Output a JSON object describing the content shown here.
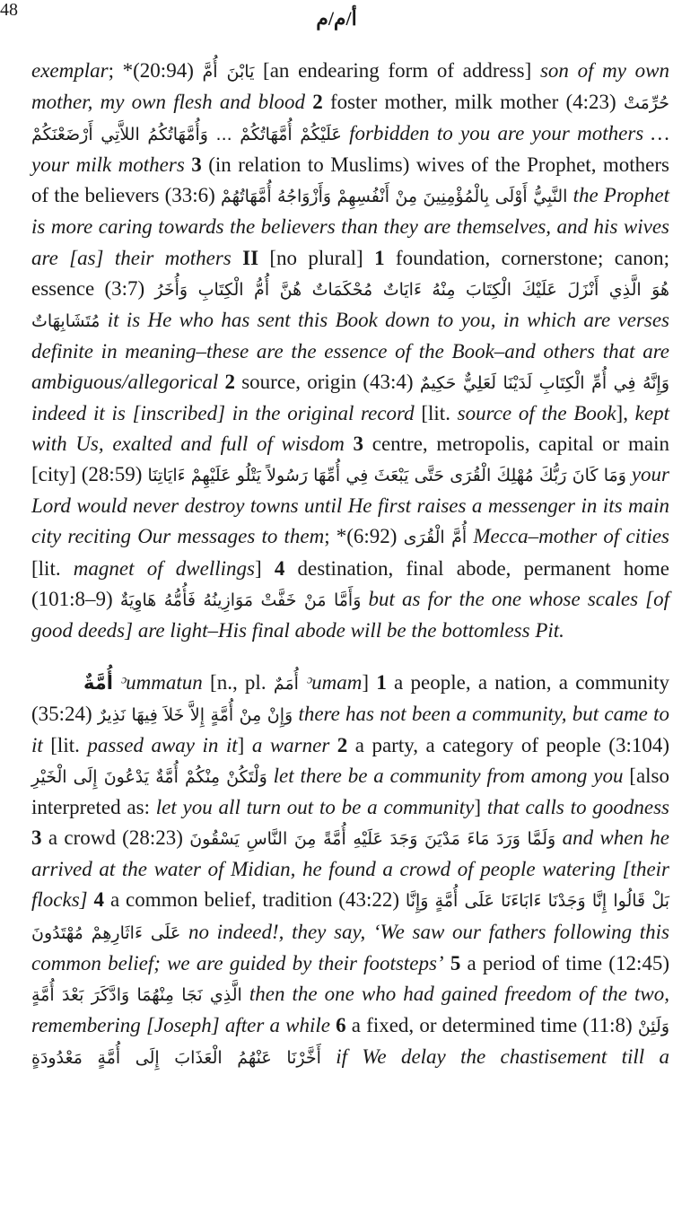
{
  "page_number": "48",
  "running_head": "أ/م/م",
  "entry_continuation": [
    {
      "t": "i",
      "v": "exemplar"
    },
    {
      "t": "n",
      "v": "; *(20:94) "
    },
    {
      "t": "a",
      "v": "يَابْنَ أُمَّ"
    },
    {
      "t": "n",
      "v": " [an endearing form of address] "
    },
    {
      "t": "i",
      "v": "son of my own mother, my own flesh and blood"
    },
    {
      "t": "n",
      "v": " "
    },
    {
      "t": "b",
      "v": "2"
    },
    {
      "t": "n",
      "v": " foster mother, milk mother (4:23) "
    },
    {
      "t": "a",
      "v": "حُرِّمَتْ عَلَيْكُمْ أُمَّهَاتُكُمْ ... وَأُمَّهَاتُكُمُ اللاَّتِي أَرْضَعْنَكُمْ"
    },
    {
      "t": "n",
      "v": " "
    },
    {
      "t": "i",
      "v": "forbidden to you are your mothers … your milk mothers"
    },
    {
      "t": "n",
      "v": " "
    },
    {
      "t": "b",
      "v": "3"
    },
    {
      "t": "n",
      "v": " (in relation to Muslims) wives of the Prophet, mothers of the believers (33:6) "
    },
    {
      "t": "a",
      "v": "النَّبِيُّ أَوْلَى بِالْمُؤْمِنِينَ مِنْ أَنْفُسِهِمْ وَأَزْوَاجُهُ أُمَّهَاتُهُمْ"
    },
    {
      "t": "n",
      "v": " "
    },
    {
      "t": "i",
      "v": "the Prophet is more caring towards the believers than they are themselves, and his wives are [as] their mothers"
    },
    {
      "t": "n",
      "v": " "
    },
    {
      "t": "b",
      "v": "II"
    },
    {
      "t": "n",
      "v": " [no plural] "
    },
    {
      "t": "b",
      "v": "1"
    },
    {
      "t": "n",
      "v": " foundation, cornerstone; canon; essence (3:7) "
    },
    {
      "t": "a",
      "v": "هُوَ الَّذِي أَنْزَلَ عَلَيْكَ الْكِتَابَ مِنْهُ ءَايَاتٌ مُحْكَمَاتٌ هُنَّ أُمُّ الْكِتَابِ وَأُخَرُ مُتَشَابِهَاتٌ"
    },
    {
      "t": "n",
      "v": " "
    },
    {
      "t": "i",
      "v": "it is He who has sent this Book down to you, in which are verses definite in meaning–these are the essence of the Book–and others that are ambiguous/allegorical"
    },
    {
      "t": "n",
      "v": " "
    },
    {
      "t": "b",
      "v": "2"
    },
    {
      "t": "n",
      "v": " source, origin (43:4) "
    },
    {
      "t": "a",
      "v": "وَإِنَّهُ فِي أُمِّ الْكِتَابِ لَدَيْنَا لَعَلِيٌّ حَكِيمٌ"
    },
    {
      "t": "n",
      "v": " "
    },
    {
      "t": "i",
      "v": "indeed it is [inscribed] in the original record"
    },
    {
      "t": "n",
      "v": " [lit. "
    },
    {
      "t": "i",
      "v": "source of the Book"
    },
    {
      "t": "n",
      "v": "], "
    },
    {
      "t": "i",
      "v": "kept with Us, exalted and full of wisdom"
    },
    {
      "t": "n",
      "v": " "
    },
    {
      "t": "b",
      "v": "3"
    },
    {
      "t": "n",
      "v": " centre, metropolis, capital or main [city] (28:59) "
    },
    {
      "t": "a",
      "v": "وَمَا كَانَ رَبُّكَ مُهْلِكَ الْقُرَى حَتَّى يَبْعَثَ فِي أُمِّهَا رَسُولاً يَتْلُو عَلَيْهِمْ ءَايَاتِنَا"
    },
    {
      "t": "n",
      "v": " "
    },
    {
      "t": "i",
      "v": "your Lord would never destroy towns until He first raises a messenger in its main city reciting Our messages to them"
    },
    {
      "t": "n",
      "v": "; *(6:92) "
    },
    {
      "t": "a",
      "v": "أُمَّ الْقُرَى"
    },
    {
      "t": "n",
      "v": " "
    },
    {
      "t": "i",
      "v": "Mecca–mother of cities"
    },
    {
      "t": "n",
      "v": " [lit. "
    },
    {
      "t": "i",
      "v": "magnet of dwellings"
    },
    {
      "t": "n",
      "v": "] "
    },
    {
      "t": "b",
      "v": "4"
    },
    {
      "t": "n",
      "v": " destination, final abode, permanent home (101:8–9) "
    },
    {
      "t": "a",
      "v": "وَأَمَّا مَنْ خَفَّتْ مَوَازِينُهُ فَأُمُّهُ هَاوِيَةٌ"
    },
    {
      "t": "n",
      "v": " "
    },
    {
      "t": "i",
      "v": "but as for the one whose scales [of good deeds] are light–His final abode will be the bottomless Pit."
    }
  ],
  "entry_ummah": [
    {
      "t": "h",
      "v": "أُمَّةٌ"
    },
    {
      "t": "n",
      "v": " "
    },
    {
      "t": "i",
      "v": "ᵓummatun"
    },
    {
      "t": "n",
      "v": " [n., pl. "
    },
    {
      "t": "a",
      "v": "أُمَمٌ"
    },
    {
      "t": "n",
      "v": " "
    },
    {
      "t": "i",
      "v": "ᵓumam"
    },
    {
      "t": "n",
      "v": "] "
    },
    {
      "t": "b",
      "v": "1"
    },
    {
      "t": "n",
      "v": " a people, a nation, a community (35:24) "
    },
    {
      "t": "a",
      "v": "وَإِنْ مِنْ أُمَّةٍ إِلاَّ خَلاَ فِيهَا نَذِيرٌ"
    },
    {
      "t": "n",
      "v": " "
    },
    {
      "t": "i",
      "v": "there has not been a community, but came to it"
    },
    {
      "t": "n",
      "v": " [lit. "
    },
    {
      "t": "i",
      "v": "passed away in it"
    },
    {
      "t": "n",
      "v": "] "
    },
    {
      "t": "i",
      "v": "a warner"
    },
    {
      "t": "n",
      "v": " "
    },
    {
      "t": "b",
      "v": "2"
    },
    {
      "t": "n",
      "v": " a party, a category of people (3:104) "
    },
    {
      "t": "a",
      "v": "وَلْتَكُنْ مِنْكُمْ أُمَّةٌ يَدْعُونَ إِلَى الْخَيْرِ"
    },
    {
      "t": "n",
      "v": " "
    },
    {
      "t": "i",
      "v": "let there be a community from among you"
    },
    {
      "t": "n",
      "v": " [also interpreted as: "
    },
    {
      "t": "i",
      "v": "let you all turn out to be a community"
    },
    {
      "t": "n",
      "v": "] "
    },
    {
      "t": "i",
      "v": "that calls to goodness"
    },
    {
      "t": "n",
      "v": " "
    },
    {
      "t": "b",
      "v": "3"
    },
    {
      "t": "n",
      "v": " a crowd (28:23) "
    },
    {
      "t": "a",
      "v": "وَلَمَّا وَرَدَ مَاءَ مَدْيَنَ وَجَدَ عَلَيْهِ أُمَّةً مِنَ النَّاسِ يَسْقُونَ"
    },
    {
      "t": "n",
      "v": " "
    },
    {
      "t": "i",
      "v": "and when he arrived at the water of Midian, he found a crowd of people watering [their flocks]"
    },
    {
      "t": "n",
      "v": " "
    },
    {
      "t": "b",
      "v": "4"
    },
    {
      "t": "n",
      "v": " a common belief, tradition (43:22) "
    },
    {
      "t": "a",
      "v": "بَلْ قَالُوا إِنَّا وَجَدْنَا ءَابَاءَنَا عَلَى أُمَّةٍ وَإِنَّا عَلَى ءَاثَارِهِمْ مُهْتَدُونَ"
    },
    {
      "t": "n",
      "v": " "
    },
    {
      "t": "i",
      "v": "no indeed!, they say, ‘We saw our fathers following this common belief; we are guided by their footsteps’"
    },
    {
      "t": "n",
      "v": " "
    },
    {
      "t": "b",
      "v": "5"
    },
    {
      "t": "n",
      "v": " a period of time (12:45) "
    },
    {
      "t": "a",
      "v": "الَّذِي نَجَا مِنْهُمَا وَادَّكَرَ بَعْدَ أُمَّةٍ"
    },
    {
      "t": "n",
      "v": " "
    },
    {
      "t": "i",
      "v": "then the one who had gained freedom of the two, remembering [Joseph] after a while"
    },
    {
      "t": "n",
      "v": " "
    },
    {
      "t": "b",
      "v": "6"
    },
    {
      "t": "n",
      "v": " a fixed, or determined time (11:8) "
    },
    {
      "t": "a",
      "v": "وَلَئِنْ أَخَّرْنَا عَنْهُمُ الْعَذَابَ إِلَى أُمَّةٍ مَعْدُودَةٍ"
    },
    {
      "t": "n",
      "v": " "
    },
    {
      "t": "i",
      "v": "if We delay the chastisement till a"
    }
  ]
}
